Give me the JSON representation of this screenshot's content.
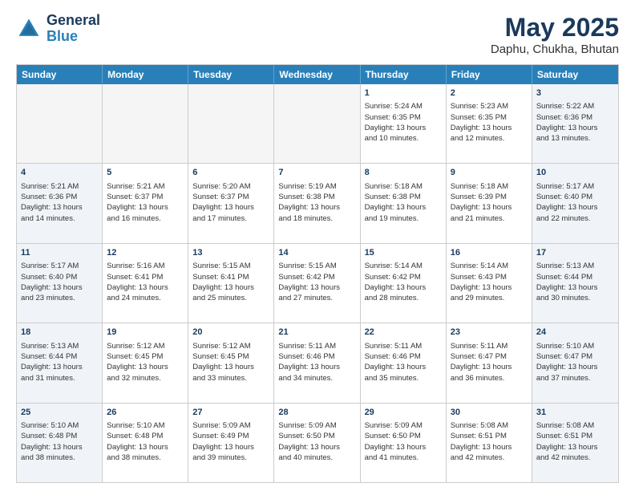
{
  "header": {
    "logo_line1": "General",
    "logo_line2": "Blue",
    "title": "May 2025",
    "subtitle": "Daphu, Chukha, Bhutan"
  },
  "weekdays": [
    "Sunday",
    "Monday",
    "Tuesday",
    "Wednesday",
    "Thursday",
    "Friday",
    "Saturday"
  ],
  "rows": [
    [
      {
        "day": "",
        "empty": true,
        "weekend": false,
        "lines": []
      },
      {
        "day": "",
        "empty": true,
        "weekend": false,
        "lines": []
      },
      {
        "day": "",
        "empty": true,
        "weekend": false,
        "lines": []
      },
      {
        "day": "",
        "empty": true,
        "weekend": false,
        "lines": []
      },
      {
        "day": "1",
        "empty": false,
        "weekend": false,
        "lines": [
          "Sunrise: 5:24 AM",
          "Sunset: 6:35 PM",
          "Daylight: 13 hours",
          "and 10 minutes."
        ]
      },
      {
        "day": "2",
        "empty": false,
        "weekend": false,
        "lines": [
          "Sunrise: 5:23 AM",
          "Sunset: 6:35 PM",
          "Daylight: 13 hours",
          "and 12 minutes."
        ]
      },
      {
        "day": "3",
        "empty": false,
        "weekend": true,
        "lines": [
          "Sunrise: 5:22 AM",
          "Sunset: 6:36 PM",
          "Daylight: 13 hours",
          "and 13 minutes."
        ]
      }
    ],
    [
      {
        "day": "4",
        "empty": false,
        "weekend": true,
        "lines": [
          "Sunrise: 5:21 AM",
          "Sunset: 6:36 PM",
          "Daylight: 13 hours",
          "and 14 minutes."
        ]
      },
      {
        "day": "5",
        "empty": false,
        "weekend": false,
        "lines": [
          "Sunrise: 5:21 AM",
          "Sunset: 6:37 PM",
          "Daylight: 13 hours",
          "and 16 minutes."
        ]
      },
      {
        "day": "6",
        "empty": false,
        "weekend": false,
        "lines": [
          "Sunrise: 5:20 AM",
          "Sunset: 6:37 PM",
          "Daylight: 13 hours",
          "and 17 minutes."
        ]
      },
      {
        "day": "7",
        "empty": false,
        "weekend": false,
        "lines": [
          "Sunrise: 5:19 AM",
          "Sunset: 6:38 PM",
          "Daylight: 13 hours",
          "and 18 minutes."
        ]
      },
      {
        "day": "8",
        "empty": false,
        "weekend": false,
        "lines": [
          "Sunrise: 5:18 AM",
          "Sunset: 6:38 PM",
          "Daylight: 13 hours",
          "and 19 minutes."
        ]
      },
      {
        "day": "9",
        "empty": false,
        "weekend": false,
        "lines": [
          "Sunrise: 5:18 AM",
          "Sunset: 6:39 PM",
          "Daylight: 13 hours",
          "and 21 minutes."
        ]
      },
      {
        "day": "10",
        "empty": false,
        "weekend": true,
        "lines": [
          "Sunrise: 5:17 AM",
          "Sunset: 6:40 PM",
          "Daylight: 13 hours",
          "and 22 minutes."
        ]
      }
    ],
    [
      {
        "day": "11",
        "empty": false,
        "weekend": true,
        "lines": [
          "Sunrise: 5:17 AM",
          "Sunset: 6:40 PM",
          "Daylight: 13 hours",
          "and 23 minutes."
        ]
      },
      {
        "day": "12",
        "empty": false,
        "weekend": false,
        "lines": [
          "Sunrise: 5:16 AM",
          "Sunset: 6:41 PM",
          "Daylight: 13 hours",
          "and 24 minutes."
        ]
      },
      {
        "day": "13",
        "empty": false,
        "weekend": false,
        "lines": [
          "Sunrise: 5:15 AM",
          "Sunset: 6:41 PM",
          "Daylight: 13 hours",
          "and 25 minutes."
        ]
      },
      {
        "day": "14",
        "empty": false,
        "weekend": false,
        "lines": [
          "Sunrise: 5:15 AM",
          "Sunset: 6:42 PM",
          "Daylight: 13 hours",
          "and 27 minutes."
        ]
      },
      {
        "day": "15",
        "empty": false,
        "weekend": false,
        "lines": [
          "Sunrise: 5:14 AM",
          "Sunset: 6:42 PM",
          "Daylight: 13 hours",
          "and 28 minutes."
        ]
      },
      {
        "day": "16",
        "empty": false,
        "weekend": false,
        "lines": [
          "Sunrise: 5:14 AM",
          "Sunset: 6:43 PM",
          "Daylight: 13 hours",
          "and 29 minutes."
        ]
      },
      {
        "day": "17",
        "empty": false,
        "weekend": true,
        "lines": [
          "Sunrise: 5:13 AM",
          "Sunset: 6:44 PM",
          "Daylight: 13 hours",
          "and 30 minutes."
        ]
      }
    ],
    [
      {
        "day": "18",
        "empty": false,
        "weekend": true,
        "lines": [
          "Sunrise: 5:13 AM",
          "Sunset: 6:44 PM",
          "Daylight: 13 hours",
          "and 31 minutes."
        ]
      },
      {
        "day": "19",
        "empty": false,
        "weekend": false,
        "lines": [
          "Sunrise: 5:12 AM",
          "Sunset: 6:45 PM",
          "Daylight: 13 hours",
          "and 32 minutes."
        ]
      },
      {
        "day": "20",
        "empty": false,
        "weekend": false,
        "lines": [
          "Sunrise: 5:12 AM",
          "Sunset: 6:45 PM",
          "Daylight: 13 hours",
          "and 33 minutes."
        ]
      },
      {
        "day": "21",
        "empty": false,
        "weekend": false,
        "lines": [
          "Sunrise: 5:11 AM",
          "Sunset: 6:46 PM",
          "Daylight: 13 hours",
          "and 34 minutes."
        ]
      },
      {
        "day": "22",
        "empty": false,
        "weekend": false,
        "lines": [
          "Sunrise: 5:11 AM",
          "Sunset: 6:46 PM",
          "Daylight: 13 hours",
          "and 35 minutes."
        ]
      },
      {
        "day": "23",
        "empty": false,
        "weekend": false,
        "lines": [
          "Sunrise: 5:11 AM",
          "Sunset: 6:47 PM",
          "Daylight: 13 hours",
          "and 36 minutes."
        ]
      },
      {
        "day": "24",
        "empty": false,
        "weekend": true,
        "lines": [
          "Sunrise: 5:10 AM",
          "Sunset: 6:47 PM",
          "Daylight: 13 hours",
          "and 37 minutes."
        ]
      }
    ],
    [
      {
        "day": "25",
        "empty": false,
        "weekend": true,
        "lines": [
          "Sunrise: 5:10 AM",
          "Sunset: 6:48 PM",
          "Daylight: 13 hours",
          "and 38 minutes."
        ]
      },
      {
        "day": "26",
        "empty": false,
        "weekend": false,
        "lines": [
          "Sunrise: 5:10 AM",
          "Sunset: 6:48 PM",
          "Daylight: 13 hours",
          "and 38 minutes."
        ]
      },
      {
        "day": "27",
        "empty": false,
        "weekend": false,
        "lines": [
          "Sunrise: 5:09 AM",
          "Sunset: 6:49 PM",
          "Daylight: 13 hours",
          "and 39 minutes."
        ]
      },
      {
        "day": "28",
        "empty": false,
        "weekend": false,
        "lines": [
          "Sunrise: 5:09 AM",
          "Sunset: 6:50 PM",
          "Daylight: 13 hours",
          "and 40 minutes."
        ]
      },
      {
        "day": "29",
        "empty": false,
        "weekend": false,
        "lines": [
          "Sunrise: 5:09 AM",
          "Sunset: 6:50 PM",
          "Daylight: 13 hours",
          "and 41 minutes."
        ]
      },
      {
        "day": "30",
        "empty": false,
        "weekend": false,
        "lines": [
          "Sunrise: 5:08 AM",
          "Sunset: 6:51 PM",
          "Daylight: 13 hours",
          "and 42 minutes."
        ]
      },
      {
        "day": "31",
        "empty": false,
        "weekend": true,
        "lines": [
          "Sunrise: 5:08 AM",
          "Sunset: 6:51 PM",
          "Daylight: 13 hours",
          "and 42 minutes."
        ]
      }
    ]
  ]
}
